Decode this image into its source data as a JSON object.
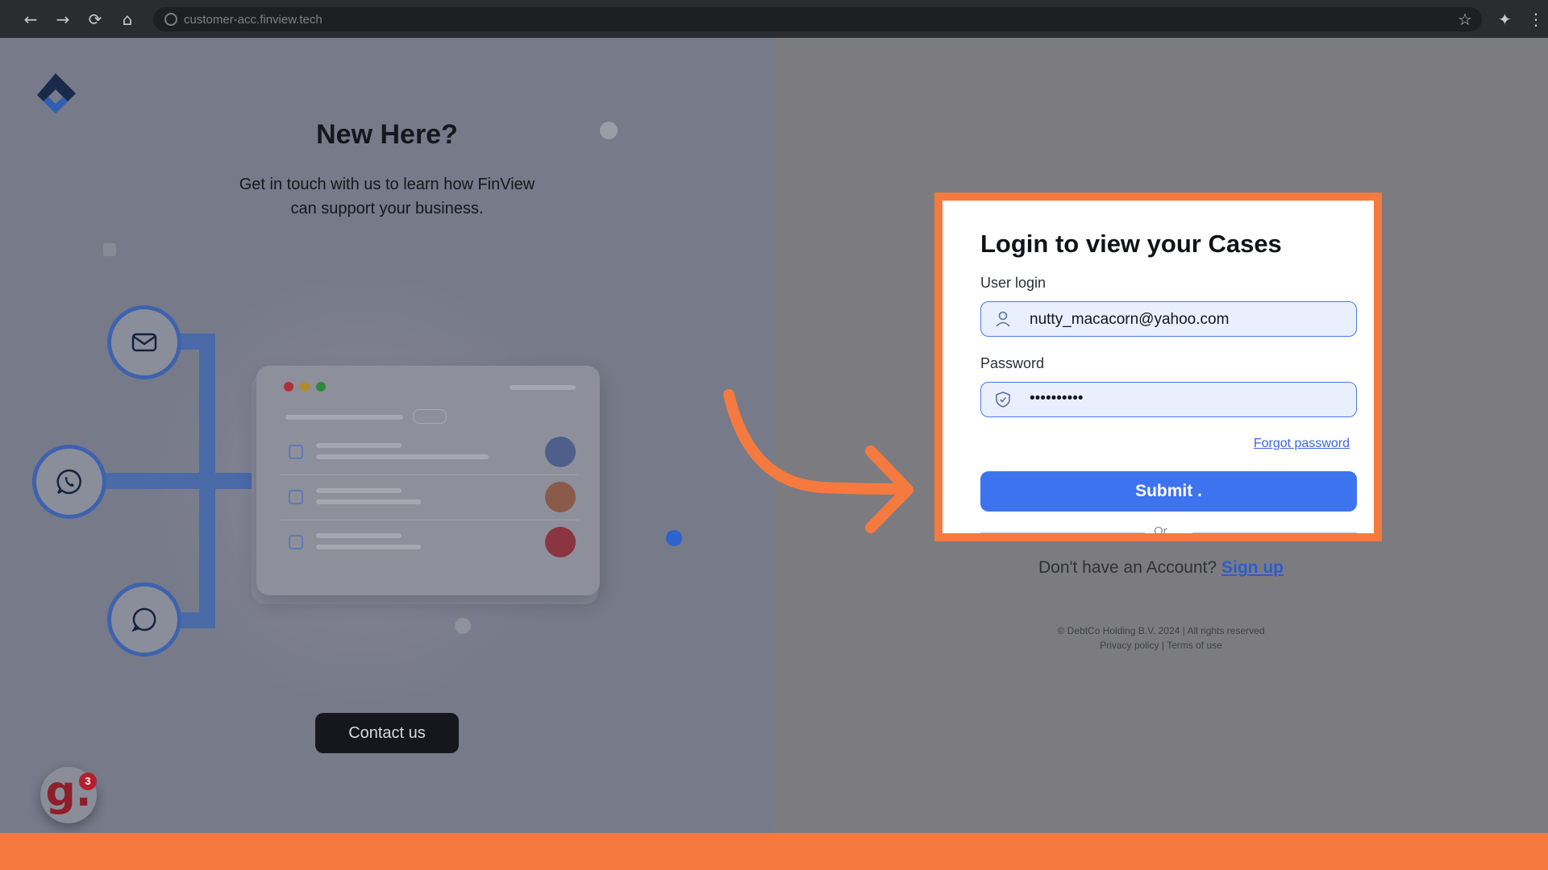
{
  "browser": {
    "url": "customer-acc.finview.tech",
    "back_icon": "←",
    "forward_icon": "→",
    "reload_icon": "⟳",
    "home_icon": "⌂",
    "star_icon": "☆",
    "extensions_icon": "✦",
    "menu_icon": "⋮"
  },
  "left": {
    "heading": "New Here?",
    "tagline": "Get in touch with us to learn how FinView can support your business.",
    "contact_label": "Contact us",
    "badge_letter": "g.",
    "badge_count": "3"
  },
  "login": {
    "title": "Login to view your Cases",
    "user_label": "User login",
    "user_value": "nutty_macacorn@yahoo.com",
    "password_label": "Password",
    "password_value": "••••••••••",
    "forgot_label": "Forgot password",
    "submit_label": "Submit .",
    "or_label": "Or"
  },
  "signup": {
    "prompt": "Don't have an Account?",
    "link_label": "Sign up"
  },
  "footer": {
    "copyright": "© DebtCo Holding B.V. 2024  |  All rights reserved",
    "privacy": "Privacy policy",
    "separator": "|",
    "terms": "Terms of use"
  },
  "colors": {
    "accent_orange": "#f47a3f",
    "primary_blue": "#3e73ef"
  }
}
